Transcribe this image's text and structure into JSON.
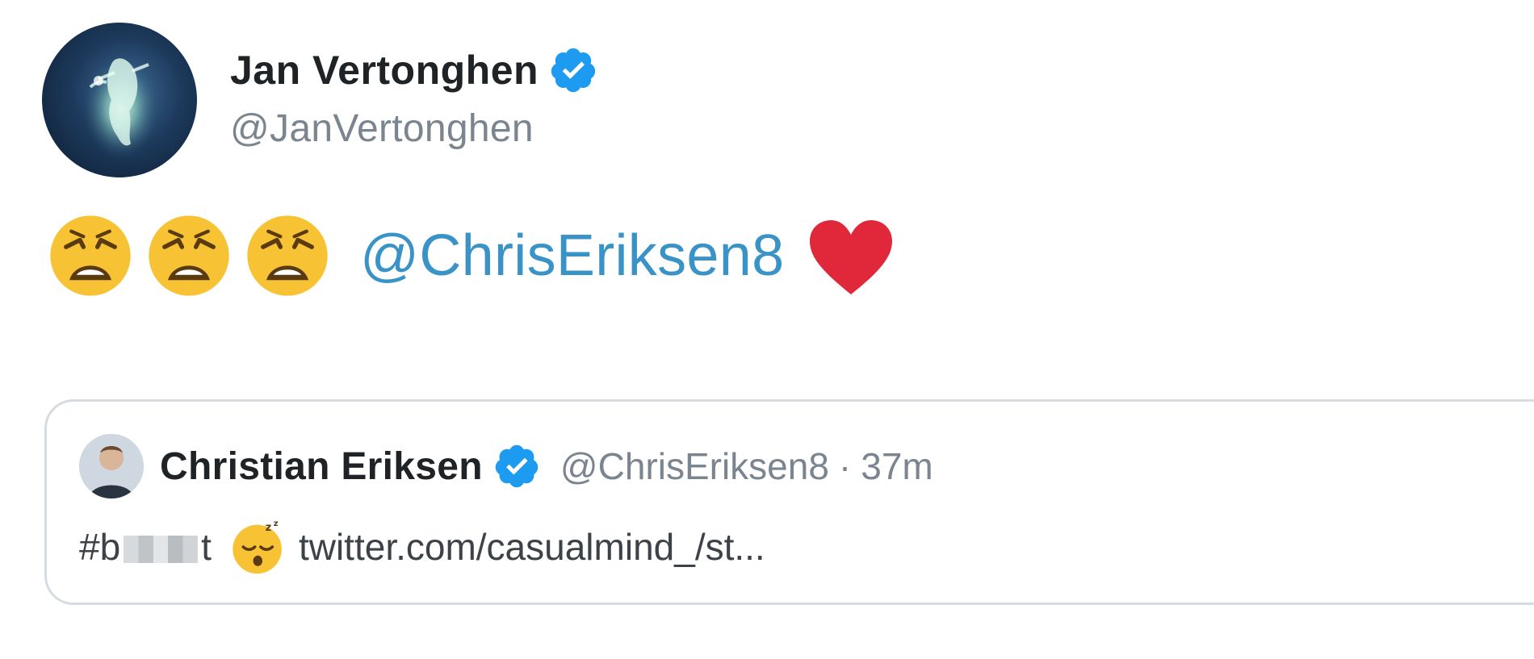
{
  "author": {
    "name": "Jan Vertonghen",
    "handle": "@JanVertonghen",
    "verified": true,
    "avatar_icon": "avatar-photo"
  },
  "body": {
    "emojis": [
      "weary-face",
      "weary-face",
      "weary-face"
    ],
    "mention": "@ChrisEriksen8",
    "trailing_emoji": "red-heart"
  },
  "quoted_tweet": {
    "name": "Christian Eriksen",
    "handle": "@ChrisEriksen8",
    "separator": "·",
    "time": "37m",
    "verified": true,
    "hashtag_prefix": "#b",
    "hashtag_suffix": "t",
    "emoji": "sleeping-face",
    "link": "twitter.com/casualmind_/st..."
  },
  "colors": {
    "verified_blue": "#1d9bf0",
    "mention_blue": "#3a93c7",
    "handle_gray": "#7a8590",
    "heart_red": "#e0245e",
    "border_gray": "#d6dbdf"
  }
}
